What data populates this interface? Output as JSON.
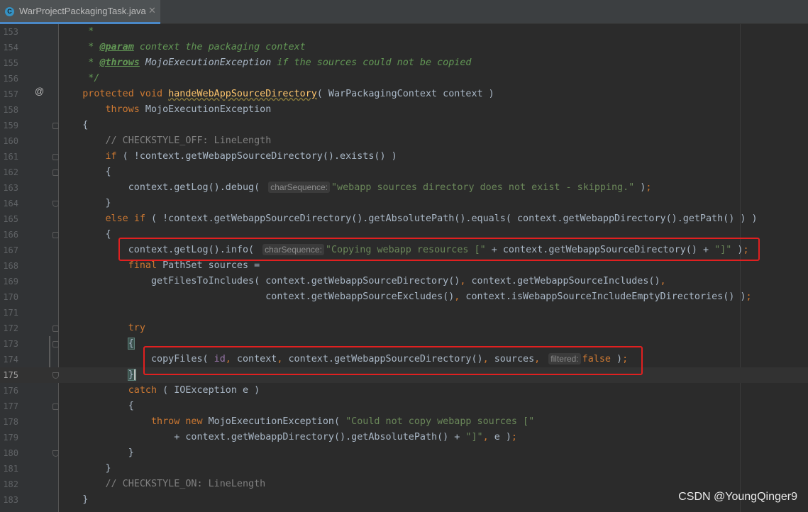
{
  "tab": {
    "filename": "WarProjectPackagingTask.java",
    "icon": "class-c-icon",
    "close_glyph": "✕"
  },
  "gutter": {
    "override_marker": "@"
  },
  "lines": [
    {
      "n": "153",
      "text": "     *"
    },
    {
      "n": "154",
      "text": "     * @param context the packaging context"
    },
    {
      "n": "155",
      "text": "     * @throws MojoExecutionException if the sources could not be copied"
    },
    {
      "n": "156",
      "text": "     */"
    },
    {
      "n": "157",
      "text": "    protected void handeWebAppSourceDirectory( WarPackagingContext context )"
    },
    {
      "n": "158",
      "text": "        throws MojoExecutionException"
    },
    {
      "n": "159",
      "text": "    {"
    },
    {
      "n": "160",
      "text": "        // CHECKSTYLE_OFF: LineLength"
    },
    {
      "n": "161",
      "text": "        if ( !context.getWebappSourceDirectory().exists() )"
    },
    {
      "n": "162",
      "text": "        {"
    },
    {
      "n": "163",
      "text": "            context.getLog().debug( charSequence: \"webapp sources directory does not exist - skipping.\" );"
    },
    {
      "n": "164",
      "text": "        }"
    },
    {
      "n": "165",
      "text": "        else if ( !context.getWebappSourceDirectory().getAbsolutePath().equals( context.getWebappDirectory().getPath() ) )"
    },
    {
      "n": "166",
      "text": "        {"
    },
    {
      "n": "167",
      "text": "            context.getLog().info( charSequence: \"Copying webapp resources [\" + context.getWebappSourceDirectory() + \"]\" );"
    },
    {
      "n": "168",
      "text": "            final PathSet sources ="
    },
    {
      "n": "169",
      "text": "                getFilesToIncludes( context.getWebappSourceDirectory(), context.getWebappSourceIncludes(),"
    },
    {
      "n": "170",
      "text": "                                    context.getWebappSourceExcludes(), context.isWebappSourceIncludeEmptyDirectories() );"
    },
    {
      "n": "171",
      "text": ""
    },
    {
      "n": "172",
      "text": "            try"
    },
    {
      "n": "173",
      "text": "            {"
    },
    {
      "n": "174",
      "text": "                copyFiles( id, context, context.getWebappSourceDirectory(), sources, filtered: false );"
    },
    {
      "n": "175",
      "text": "            }"
    },
    {
      "n": "176",
      "text": "            catch ( IOException e )"
    },
    {
      "n": "177",
      "text": "            {"
    },
    {
      "n": "178",
      "text": "                throw new MojoExecutionException( \"Could not copy webapp sources [\""
    },
    {
      "n": "179",
      "text": "                    + context.getWebappDirectory().getAbsolutePath() + \"]\", e );"
    },
    {
      "n": "180",
      "text": "            }"
    },
    {
      "n": "181",
      "text": "        }"
    },
    {
      "n": "182",
      "text": "        // CHECKSTYLE_ON: LineLength"
    },
    {
      "n": "183",
      "text": "    }"
    }
  ],
  "current_line": "175",
  "highlights": [
    {
      "line": "167",
      "color": "#e02020"
    },
    {
      "line": "174",
      "color": "#e02020"
    }
  ],
  "watermark": "CSDN @YoungQinger9",
  "colors": {
    "editor_bg": "#2b2b2b",
    "keyword": "#cc7832",
    "string": "#6a8759",
    "method_decl": "#ffc66d",
    "field": "#9876aa",
    "comment": "#808080",
    "highlight_box": "#e02020"
  }
}
